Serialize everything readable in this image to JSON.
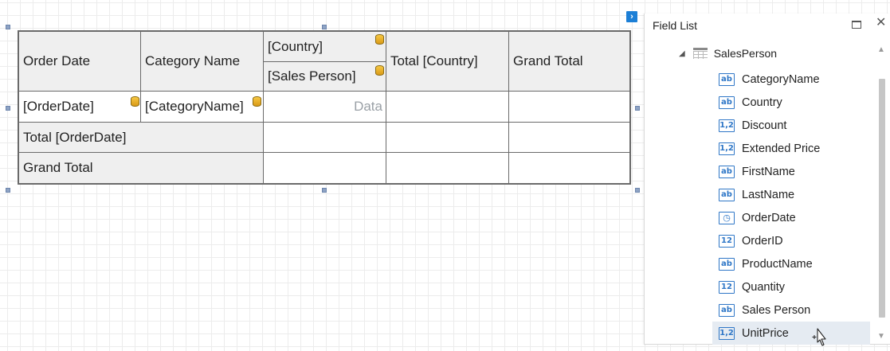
{
  "pivot": {
    "headers": {
      "order_date": "Order Date",
      "category_name": "Category Name",
      "country": "[Country]",
      "sales_person": "[Sales Person]",
      "total_country": "Total [Country]",
      "grand_total": "Grand Total"
    },
    "row_fields": {
      "order_date": "[OrderDate]",
      "category_name": "[CategoryName]",
      "data": "Data"
    },
    "totals": {
      "total_order_date": "Total [OrderDate]",
      "grand_total": "Grand Total"
    }
  },
  "field_list": {
    "title": "Field List",
    "close_glyph": "✕",
    "root": {
      "expander": "◢",
      "label": "SalesPerson"
    },
    "fields": [
      {
        "label": "CategoryName",
        "type": "ab",
        "icon": "string-type-icon"
      },
      {
        "label": "Country",
        "type": "ab",
        "icon": "string-type-icon"
      },
      {
        "label": "Discount",
        "type": "1,2",
        "icon": "decimal-type-icon"
      },
      {
        "label": "Extended Price",
        "type": "1,2",
        "icon": "decimal-type-icon"
      },
      {
        "label": "FirstName",
        "type": "ab",
        "icon": "string-type-icon"
      },
      {
        "label": "LastName",
        "type": "ab",
        "icon": "string-type-icon"
      },
      {
        "label": "OrderDate",
        "type": "◷",
        "icon": "datetime-type-icon"
      },
      {
        "label": "OrderID",
        "type": "12",
        "icon": "integer-type-icon"
      },
      {
        "label": "ProductName",
        "type": "ab",
        "icon": "string-type-icon"
      },
      {
        "label": "Quantity",
        "type": "12",
        "icon": "integer-type-icon"
      },
      {
        "label": "Sales Person",
        "type": "ab",
        "icon": "string-type-icon"
      },
      {
        "label": "UnitPrice",
        "type": "1,2",
        "icon": "decimal-type-icon",
        "selected": true
      }
    ]
  },
  "smart_tag_glyph": "›",
  "colors": {
    "accent": "#2f77c7",
    "header_bg": "#efefef",
    "selection_bg": "#e5ebf2",
    "smart_tag": "#1c7fd6"
  }
}
